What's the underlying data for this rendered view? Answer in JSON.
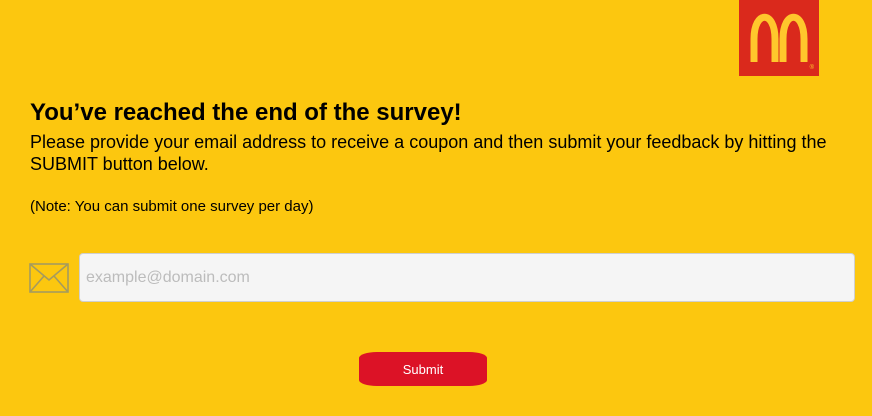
{
  "brand": {
    "logo_icon": "golden-arches-icon",
    "registered_mark": "®",
    "colors": {
      "background": "#fcc70f",
      "logo_red": "#da291c",
      "arches_yellow": "#ffc72c",
      "button_red": "#dc1226"
    }
  },
  "survey_end": {
    "title": "You’ve reached the end of the survey!",
    "description": "Please provide your email address to receive a coupon and then submit your feedback by hitting the SUBMIT button below.",
    "note": "(Note: You can submit one survey per day)"
  },
  "email_form": {
    "icon": "envelope-icon",
    "value": "",
    "placeholder": "example@domain.com",
    "submit_label": "Submit"
  }
}
